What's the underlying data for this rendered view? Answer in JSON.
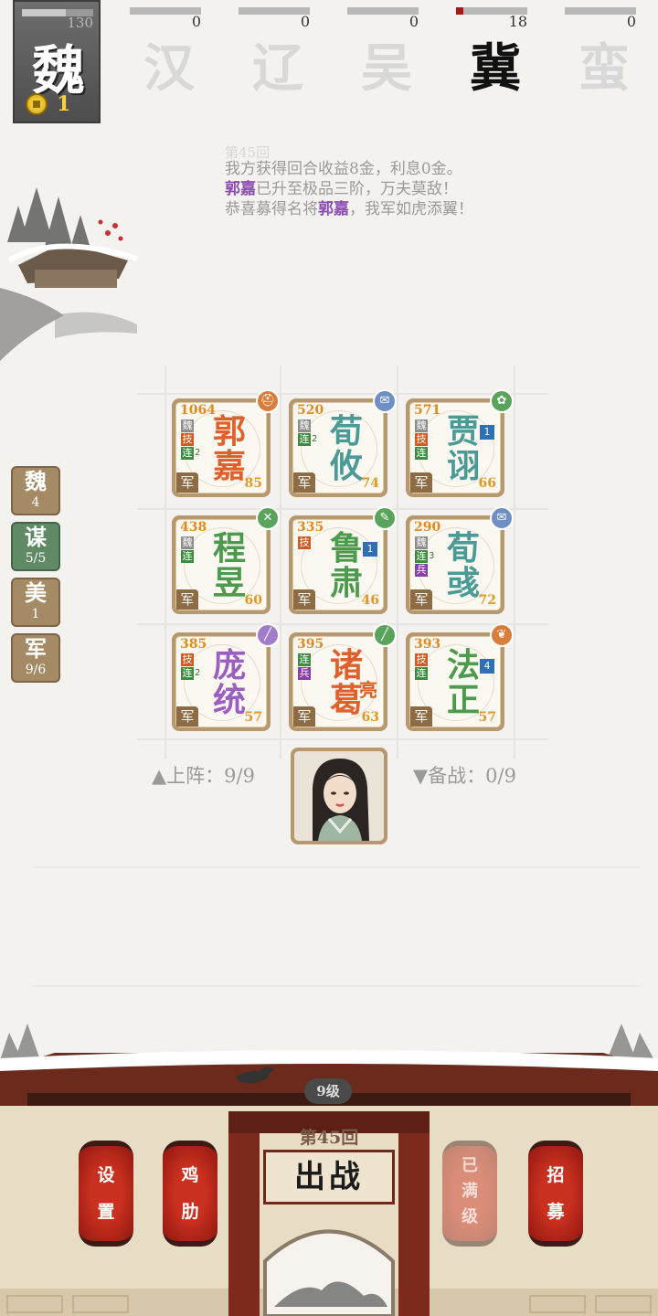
{
  "factions": [
    {
      "name": "魏",
      "hp": 130,
      "hp_fraction": 0.62,
      "gold": 1,
      "active": true
    },
    {
      "name": "汉",
      "hp": 0,
      "hp_fraction": 0
    },
    {
      "name": "辽",
      "hp": 0,
      "hp_fraction": 0
    },
    {
      "name": "吴",
      "hp": 0,
      "hp_fraction": 0
    },
    {
      "name": "冀",
      "hp": 18,
      "hp_fraction": 0.1,
      "alive": true
    },
    {
      "name": "蛮",
      "hp": 0,
      "hp_fraction": 0
    }
  ],
  "log": {
    "line0": "第45回",
    "line1": "我方获得回合收益8金，利息0金。",
    "line2_name": "郭嘉",
    "line2_rest": "已升至极品三阶，万夫莫敌！",
    "line3_pre": "恭喜募得名将",
    "line3_name": "郭嘉",
    "line3_post": "，我军如虎添翼！"
  },
  "side_tags": [
    {
      "title": "魏",
      "value": "4"
    },
    {
      "title": "谋",
      "value": "5/5"
    },
    {
      "title": "美",
      "value": "1"
    },
    {
      "title": "军",
      "value": "9/6"
    }
  ],
  "heroes": [
    {
      "name1": "郭",
      "name2": "嘉",
      "power": "1064",
      "level": "85",
      "jun": "军",
      "badges": [
        "魏",
        "技",
        "连"
      ],
      "lian_n": "2",
      "icon": "helmet-icon"
    },
    {
      "name1": "荀",
      "name2": "攸",
      "power": "520",
      "level": "74",
      "jun": "军",
      "badges": [
        "魏",
        "连"
      ],
      "lian_n": "2",
      "icon": "scroll-icon"
    },
    {
      "name1": "贾",
      "name2": "诩",
      "power": "571",
      "level": "66",
      "jun": "军",
      "badges": [
        "魏",
        "技",
        "连"
      ],
      "star": "1",
      "icon": "fan-icon"
    },
    {
      "name1": "程",
      "name2": "昱",
      "power": "438",
      "level": "60",
      "jun": "军",
      "badges": [
        "魏",
        "连"
      ],
      "icon": "swords-icon"
    },
    {
      "name1": "鲁",
      "name2": "肃",
      "power": "335",
      "level": "46",
      "jun": "军",
      "badges": [
        "技"
      ],
      "star": "1",
      "icon": "brush-icon"
    },
    {
      "name1": "荀",
      "name2": "彧",
      "power": "290",
      "level": "72",
      "jun": "军",
      "badges": [
        "魏",
        "连",
        "兵"
      ],
      "lian_n": "3",
      "icon": "scroll-icon"
    },
    {
      "name1": "庞",
      "name2": "统",
      "power": "385",
      "level": "57",
      "jun": "军",
      "badges": [
        "技",
        "连"
      ],
      "lian_n": "2",
      "icon": "sword-icon"
    },
    {
      "name1": "诸",
      "name2": "葛",
      "name3": "亮",
      "power": "395",
      "level": "63",
      "jun": "军",
      "badges": [
        "连",
        "兵"
      ],
      "icon": "sword-icon"
    },
    {
      "name1": "法",
      "name2": "正",
      "power": "393",
      "level": "57",
      "jun": "军",
      "badges": [
        "技",
        "连"
      ],
      "star": "4",
      "icon": "pouch-icon"
    }
  ],
  "deploy": {
    "on_field": "▲上阵：9/9",
    "bench": "▼备战：0/9"
  },
  "gate": {
    "level": "9级",
    "round": "第45回",
    "fight": "出战",
    "lantern_settings": [
      "设",
      "置"
    ],
    "lantern_chicken": [
      "鸡",
      "肋"
    ],
    "lantern_max": [
      "已",
      "满",
      "级"
    ],
    "lantern_recruit": [
      "招",
      "募"
    ]
  },
  "colors": {
    "accent_red": "#a91919",
    "card_border": "#b59770",
    "tag_green": "#5f8a65",
    "tag_brown": "#a58a66"
  }
}
